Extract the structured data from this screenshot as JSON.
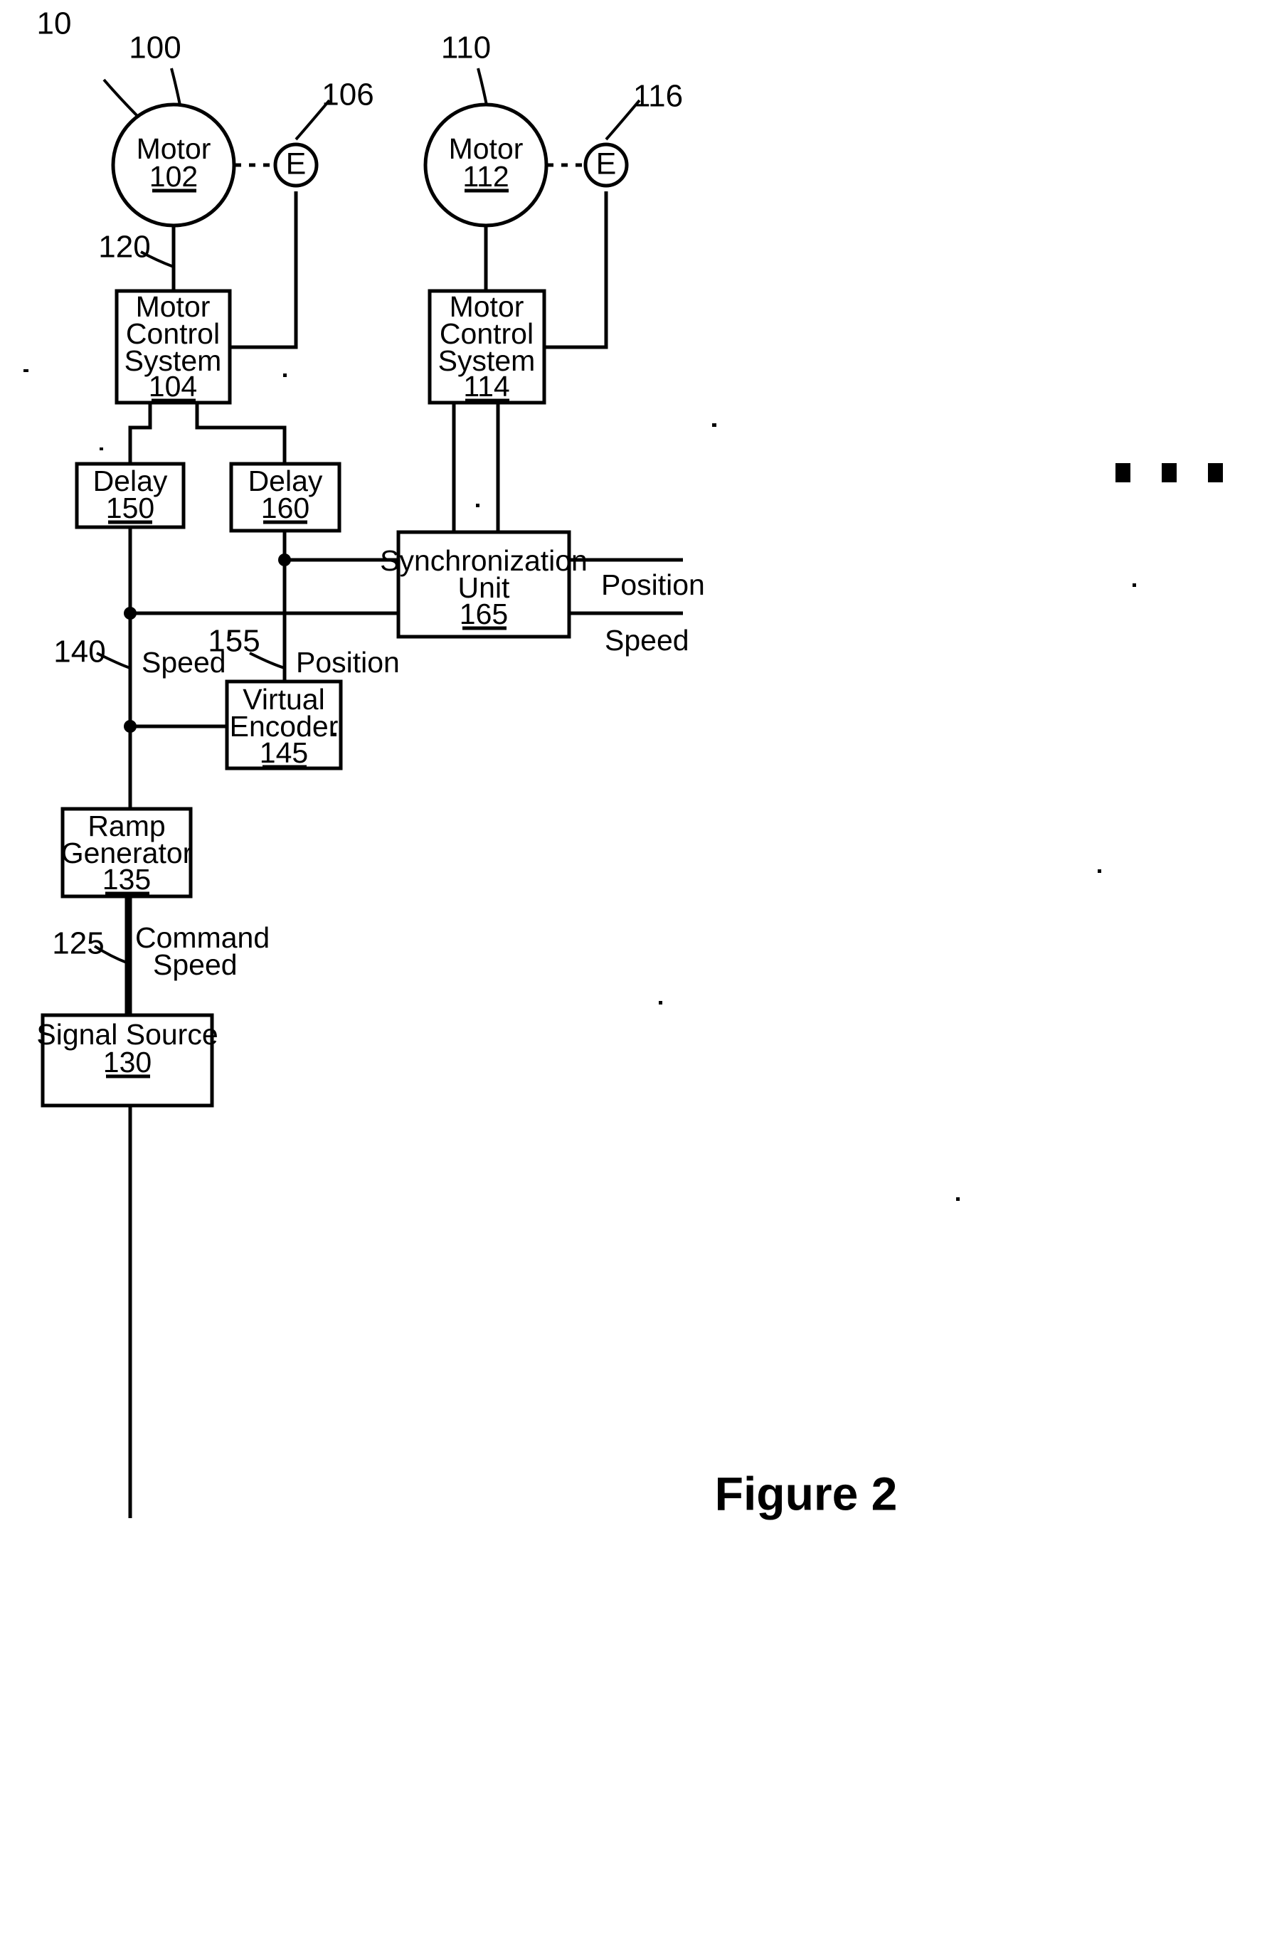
{
  "figure": {
    "caption": "Figure 2",
    "system_ref": "10"
  },
  "nodes": {
    "motor_left": {
      "label": "Motor",
      "ref": "102",
      "group_ref": "100",
      "encoder_label": "E",
      "encoder_ref": "106"
    },
    "motor_right": {
      "label": "Motor",
      "ref": "112",
      "group_ref": "110",
      "encoder_label": "E",
      "encoder_ref": "116"
    },
    "mcs_left": {
      "line1": "Motor",
      "line2": "Control",
      "line3": "System",
      "ref": "104"
    },
    "mcs_right": {
      "line1": "Motor",
      "line2": "Control",
      "line3": "System",
      "ref": "114"
    },
    "delay_left": {
      "label": "Delay",
      "ref": "150"
    },
    "delay_right": {
      "label": "Delay",
      "ref": "160"
    },
    "sync_unit": {
      "line1": "Synchronization",
      "line2": "Unit",
      "ref": "165"
    },
    "virtual_encoder": {
      "line1": "Virtual",
      "line2": "Encoder",
      "ref": "145"
    },
    "ramp_generator": {
      "line1": "Ramp",
      "line2": "Generator",
      "ref": "135"
    },
    "signal_source": {
      "label": "Signal Source",
      "ref": "130"
    }
  },
  "connector_refs": {
    "motor_to_mcs": "120",
    "speed_bus": "140",
    "position_bus": "155",
    "command_speed_bus": "125"
  },
  "signal_labels": {
    "speed_left": "Speed",
    "position_left": "Position",
    "position_out": "Position",
    "speed_out": "Speed",
    "command_line1": "Command",
    "command_line2": "Speed"
  },
  "continuation": {
    "ellipsis": "..."
  }
}
